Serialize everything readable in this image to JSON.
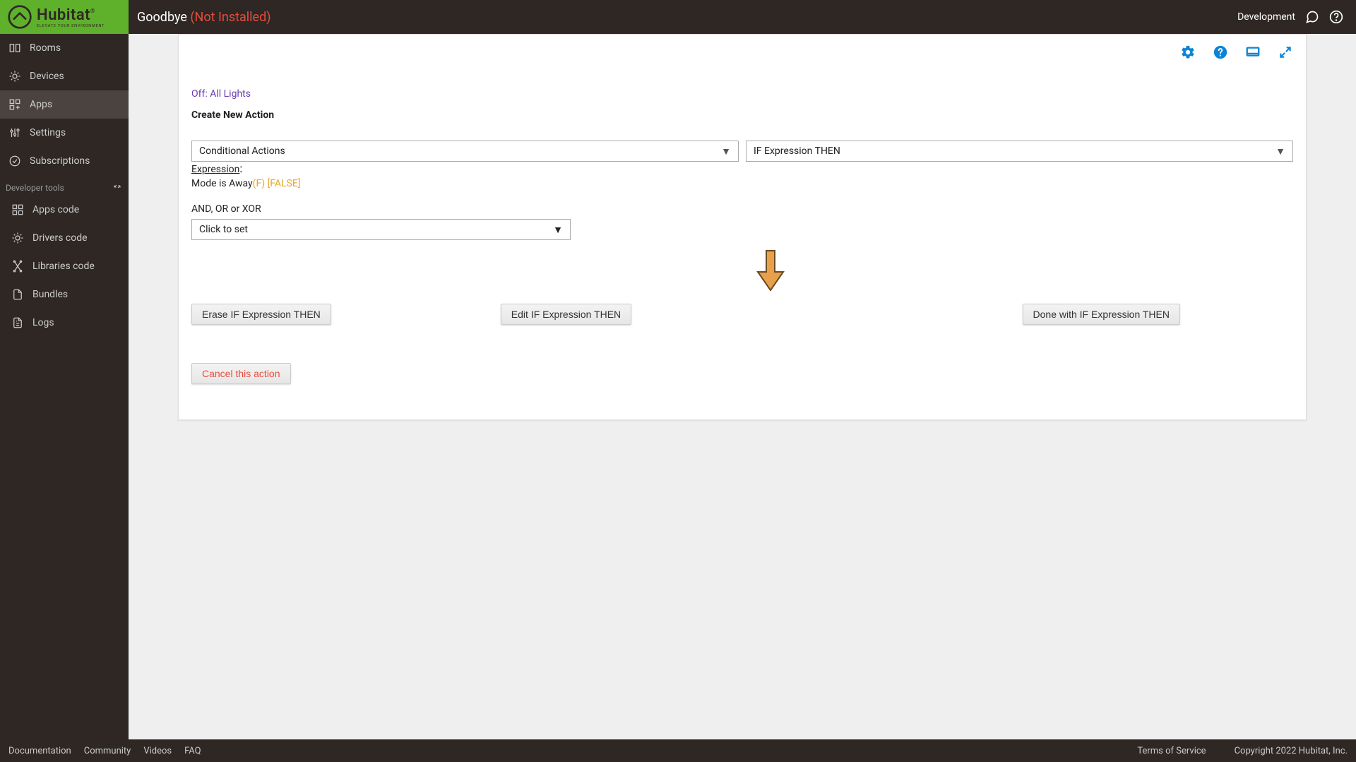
{
  "brand": {
    "name": "Hubitat",
    "tag": "ELEVATE YOUR ENVIRONMENT",
    "reg": "®"
  },
  "header": {
    "title": "Goodbye",
    "status": "(Not Installed)",
    "right": "Development"
  },
  "sidebar": {
    "items": [
      {
        "label": "Rooms"
      },
      {
        "label": "Devices"
      },
      {
        "label": "Apps"
      },
      {
        "label": "Settings"
      },
      {
        "label": "Subscriptions"
      }
    ],
    "section": "Developer tools",
    "dev_items": [
      {
        "label": "Apps code"
      },
      {
        "label": "Drivers code"
      },
      {
        "label": "Libraries code"
      },
      {
        "label": "Bundles"
      },
      {
        "label": "Logs"
      }
    ]
  },
  "main": {
    "link": "Off: All Lights",
    "section_title": "Create New Action",
    "select1": "Conditional Actions",
    "select2": "IF Expression THEN",
    "expr_label": "Expression",
    "expr_colon": ":",
    "expr_text": "Mode is Away",
    "expr_flag": "(F) [FALSE]",
    "and_label": "AND, OR or XOR",
    "and_select": "Click to set",
    "btn_erase": "Erase IF Expression THEN",
    "btn_edit": "Edit IF Expression THEN",
    "btn_done": "Done with IF Expression THEN",
    "btn_cancel": "Cancel this action"
  },
  "footer": {
    "docs": "Documentation",
    "community": "Community",
    "videos": "Videos",
    "faq": "FAQ",
    "tos": "Terms of Service",
    "copy": "Copyright 2022 Hubitat, Inc."
  }
}
